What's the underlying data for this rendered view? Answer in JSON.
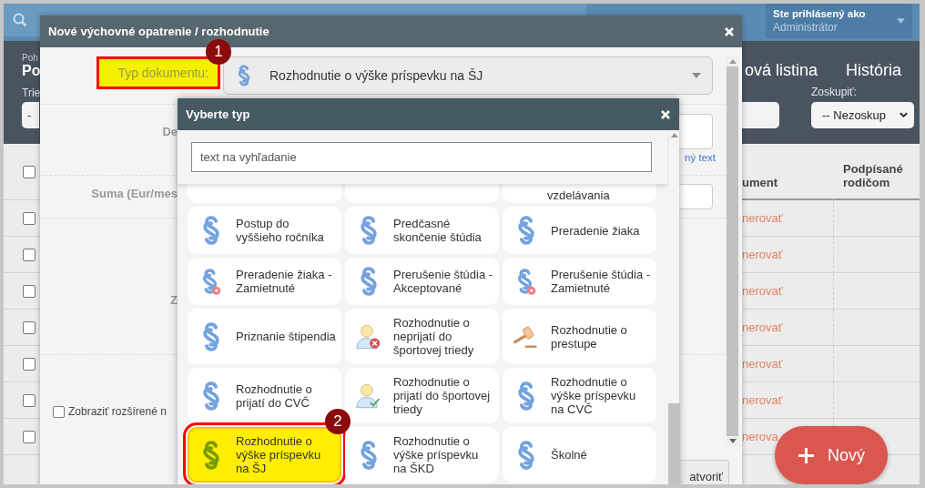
{
  "topbar": {
    "user_label": "Ste prihlásený ako",
    "user_name": "Administrátor"
  },
  "page_header": {
    "breadcrumb": "Poh",
    "title": "Po",
    "filter_label": "Trie",
    "filter_value": "-",
    "tabs": [
      {
        "label": "ová listina"
      },
      {
        "label": "História"
      }
    ],
    "group_label": "Zoskupiť:",
    "group_value": "-- Nezoskup"
  },
  "table": {
    "all_checked": false,
    "columns": [
      "ument",
      "Podpísané rodičom"
    ],
    "rows": [
      {
        "checked": false,
        "action": "nerovať"
      },
      {
        "checked": false,
        "action": "nerovať"
      },
      {
        "checked": false,
        "action": "nerovať"
      },
      {
        "checked": false,
        "action": "nerovať"
      },
      {
        "checked": false,
        "action": "nerovať"
      },
      {
        "checked": false,
        "action": "nerovať"
      },
      {
        "checked": false,
        "action": "nerova"
      }
    ]
  },
  "modal": {
    "title": "Nové výchovné opatrenie / rozhodnutie",
    "type_label": "Typ dokumentu:",
    "type_highlighted": true,
    "type_value": "Rozhodnutie o výške príspevku na ŠJ",
    "label_2": "De",
    "link": "ný text",
    "label_3": "Suma (Eur/mes",
    "label_4": "Z",
    "extended": {
      "label": "Zobraziť rozšírené n",
      "checked": false
    },
    "close_button": "atvoriť"
  },
  "picker": {
    "title": "Vyberte typ",
    "search": {
      "placeholder": "text na vyhľadanie"
    },
    "cut_label": "vzdelávania",
    "cards": [
      {
        "label": "Postup do vyššieho ročníka",
        "kind": "paragraph",
        "selected": false
      },
      {
        "label": "Predčasné skončenie štúdia",
        "kind": "paragraph",
        "selected": false
      },
      {
        "label": "Preradenie žiaka",
        "kind": "paragraph",
        "selected": false
      },
      {
        "label": "Preradenie žiaka - Zamietnuté",
        "kind": "paragraph-rejected",
        "selected": false
      },
      {
        "label": "Prerušenie štúdia - Akceptované",
        "kind": "paragraph",
        "selected": false
      },
      {
        "label": "Prerušenie štúdia - Zamietnuté",
        "kind": "paragraph-rejected",
        "selected": false
      },
      {
        "label": "Priznanie štipendia",
        "kind": "paragraph",
        "selected": false
      },
      {
        "label": "Rozhodnutie o neprijatí do športovej triedy",
        "kind": "person-rejected",
        "selected": false
      },
      {
        "label": "Rozhodnutie o prestupe",
        "kind": "gavel",
        "selected": false
      },
      {
        "label": "Rozhodnutie o prijatí do CVČ",
        "kind": "paragraph",
        "selected": false
      },
      {
        "label": "Rozhodnutie o prijatí do športovej triedy",
        "kind": "person-accepted",
        "selected": false
      },
      {
        "label": "Rozhodnutie o výške príspevku na CVČ",
        "kind": "paragraph",
        "selected": false
      },
      {
        "label": "Rozhodnutie o výške príspevku na ŠJ",
        "kind": "paragraph",
        "selected": true
      },
      {
        "label": "Rozhodnutie o výške príspevku na ŠKD",
        "kind": "paragraph",
        "selected": false
      },
      {
        "label": "Školné",
        "kind": "paragraph",
        "selected": false
      }
    ]
  },
  "callouts": [
    {
      "number": "1"
    },
    {
      "number": "2"
    }
  ],
  "new_button": {
    "label": "Nový"
  }
}
